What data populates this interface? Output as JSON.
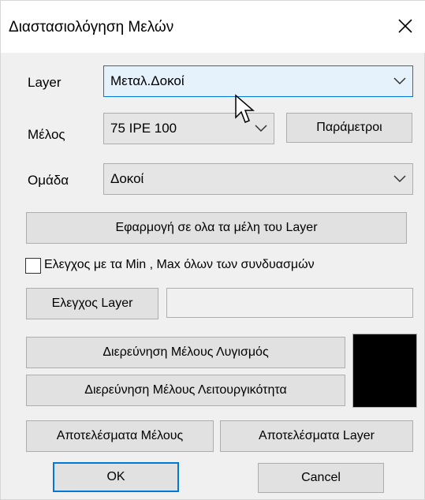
{
  "window": {
    "title": "Διαστασιολόγηση Μελών"
  },
  "layer": {
    "label": "Layer",
    "value": "Μεταλ.Δοκοί"
  },
  "member": {
    "label": "Μέλος",
    "value": "75 IPE 100",
    "params_button": "Παράμετροι"
  },
  "group": {
    "label": "Ομάδα",
    "value": "Δοκοί"
  },
  "apply_all_button": "Εφαρμογή σε ολα τα μέλη του Layer",
  "minmax_check": {
    "label": "Ελεγχος με τα Min , Max όλων των συνδυασμών",
    "checked": false
  },
  "check_layer": {
    "button": "Ελεγχος Layer",
    "field_value": ""
  },
  "buttons": {
    "investigate_fatigue": "Διερεύνηση Μέλους Λυγισμός",
    "investigate_serviceability": "Διερεύνηση Μέλους Λειτουργικότητα",
    "member_results": "Αποτελέσματα Μέλους",
    "layer_results": "Αποτελέσματα Layer",
    "ok": "OK",
    "cancel": "Cancel"
  },
  "colors": {
    "swatch": "#000000",
    "focus": "#0078d7"
  }
}
